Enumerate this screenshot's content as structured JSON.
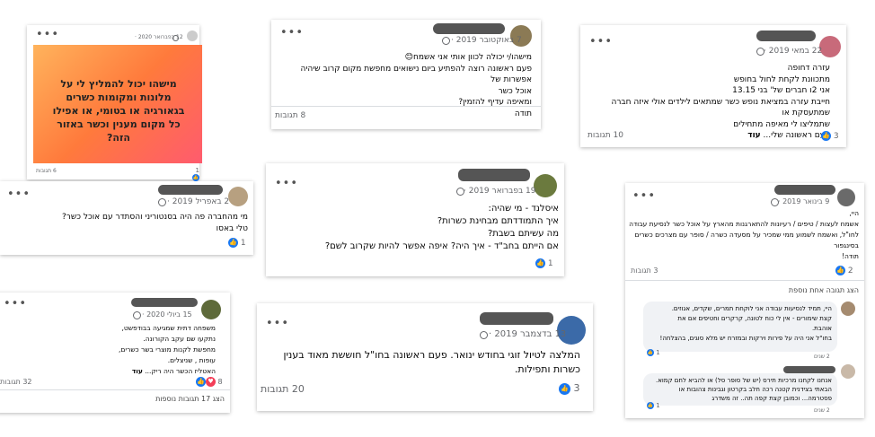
{
  "post_a": {
    "date": "12 בפברואר 2020 ·",
    "text": "מישהו יכול להמליץ לי על מלונות ומקומות כשרים בגאורגיה או בטומי, או אפילו כל מקום מענין וכשר באזור הזה?",
    "likes": "1",
    "comments": "6 תגובות"
  },
  "post_b": {
    "date": "7 באוקטובר 2019 ·",
    "lines": [
      "מישהו/י יכולה לכוון אותי אני אשמח😊",
      "פעם ראשונה רוצה להפתיע ביום נישואים מחפשת מקום קרוב שיהיה אפשרות של",
      "אוכל כשר",
      "ומאיפה עדיף להזמין?",
      "תודה"
    ],
    "comments": "8 תגובות"
  },
  "post_c": {
    "date": "22 במאי 2019 ·",
    "lines": [
      "עזרה דחופה",
      "מתכוונת לקחת לחול בחופש",
      "אני 2ו חברים של' בני 13.15",
      "חייבת עזרה במציאת נופש כשר שמתאים לילדים אולי איזה חברה שמתעסקת או",
      "שתמליצו לי מאיפה מתחילים",
      "פעם ראשונה שלי..."
    ],
    "more": "עוד",
    "likes": "3",
    "comments": "10 תגובות"
  },
  "post_d": {
    "date": "2 באפריל 2019 ·",
    "lines": [
      "מי מהחברה פה היה בסנטוריני והסתדר עם אוכל כשר?",
      "טלי באסו"
    ],
    "likes": "1"
  },
  "post_e": {
    "date": "19 בפברואר 2019 ·",
    "lines": [
      "איסלנד - מי שהיה:",
      "איך התמודדתם מבחינת כשרות?",
      "מה עשיתם בשבת?",
      "אם הייתם בחב\"ד - איך היה? איפה אפשר להיות שקרוב לשם?"
    ],
    "likes": "1"
  },
  "post_f": {
    "date": "9 בינואר 2019 ·",
    "lines": [
      "היי,",
      "אשמח לעצות / טיפים / רעיונות להתארגנות מהארץ על אוכל כשר לנסיעת עבודה",
      "לחו\"ל, ואשמח לשמוע ממי שמכיר על מסעדה כשרה / סופר עם מצרכים כשרים",
      "בסינגפור",
      "תודה!"
    ],
    "likes": "2",
    "comments": "3 תגובות",
    "show_more": "הצג תגובה אחת נוספת",
    "reply1": {
      "lines": [
        "היי, תמיד לנסיעות עבודה אני לוקחת תמרים, שקדים, אגוזים.",
        "קצת שימורים - אין לי כוח לטונה, קרקרים וחטיפים אם את",
        "אוהבת.",
        "בחו\"ל אני היה על פירות וירקות ובמזרח יש מלא סוגים, בהצלחה!"
      ],
      "likes": "1",
      "time": "2 שנים"
    },
    "reply2": {
      "lines": [
        "אנחנו לקחנו מרכיות תירס (יש של סופר סל) או להביא לחם קמוא.",
        "הבאתי בצידנית קטנה רכה חלב בקרטון וגבינות צהובות או",
        "פסטרמה... וכמובן קצת קפה תה.. זה משדרג"
      ],
      "likes": "1",
      "time": "2 שנים"
    }
  },
  "post_g": {
    "date": "15 ביולי 2020 ·",
    "lines": [
      "משפחה דתית שמגיעה בבודפשט,",
      "נתקעו שם עקב הקורונה.",
      "מחפשת לקנות מוצרי בשר כשרים,",
      "עופות , שניצלים.",
      "האטליז הכשר היה ריק..."
    ],
    "more": "עוד",
    "likes": "8",
    "comments": "32 תגובות",
    "show_more": "הצג 17 תגובות נוספות"
  },
  "post_h": {
    "date": "13 בדצמבר 2019 ·",
    "text": "המלצה לטיול זוגי בחודש ינואר. פעם ראשונה בחו\"ל חוששת מאוד בענין כשרות ותפילות.",
    "likes": "3",
    "comments": "20 תגובות"
  },
  "colors": {
    "accent": "#1877f2",
    "heart": "#f33e58",
    "gradient_start": "#ff8a2a",
    "gradient_end": "#ff4f7a"
  }
}
